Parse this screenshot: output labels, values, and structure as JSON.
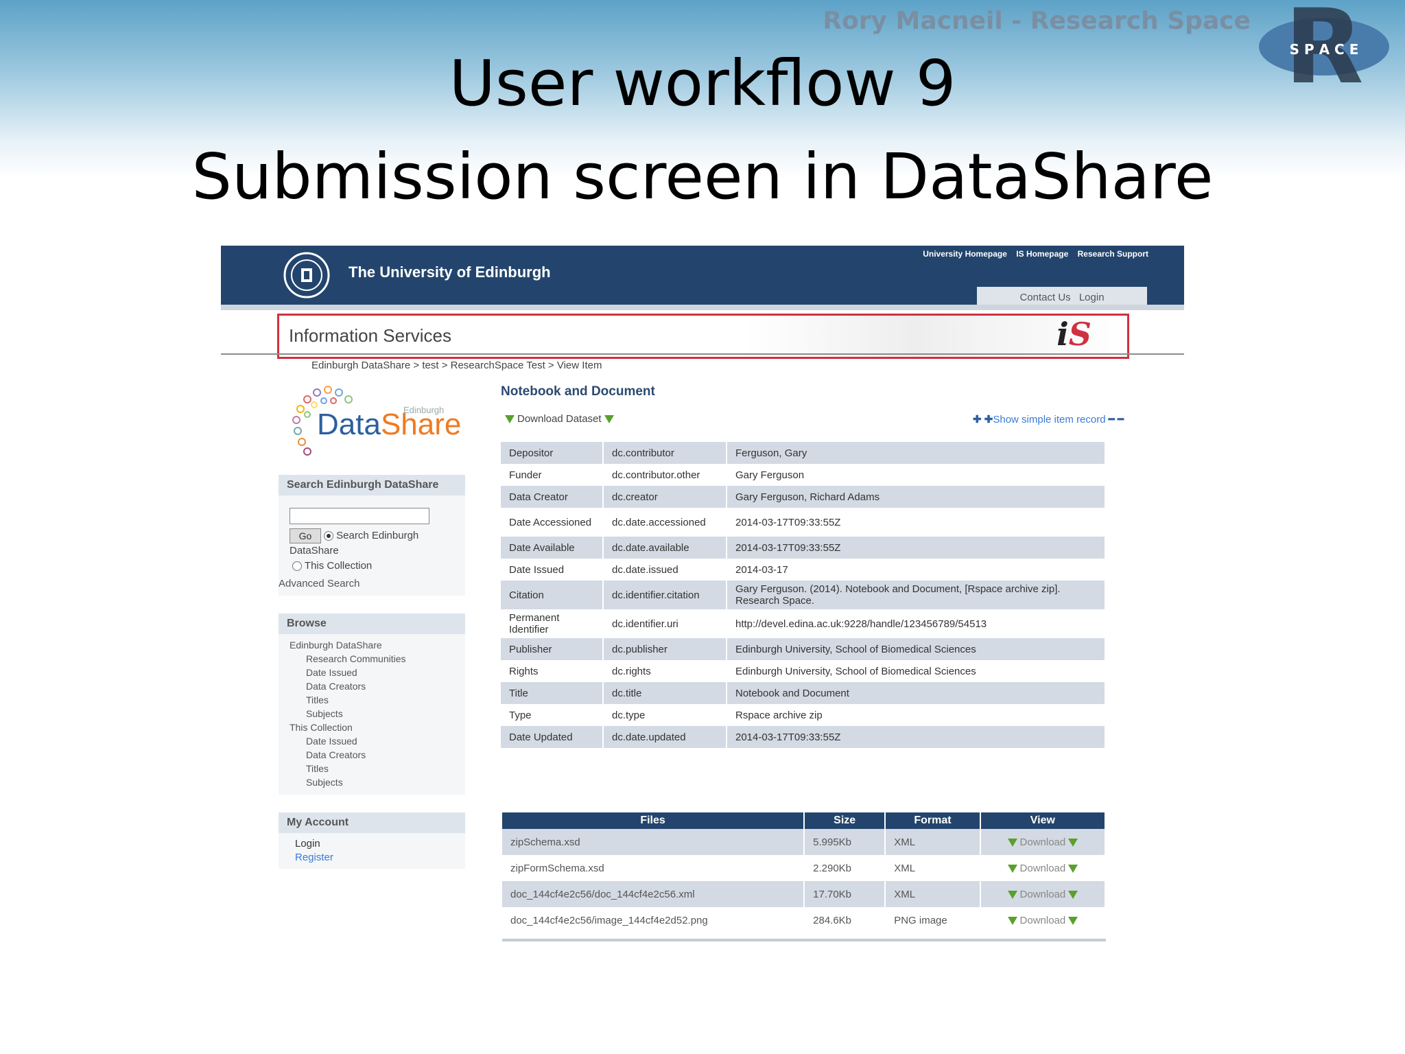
{
  "slide": {
    "author": "Rory Macneil - Research Space",
    "logo_text": "S P A C E",
    "title_line1": "User workflow 9",
    "title_line2": "Submission screen in DataShare"
  },
  "header": {
    "university": "The University of Edinburgh",
    "top_links": [
      "University Homepage",
      "IS Homepage",
      "Research Support"
    ],
    "contact": "Contact Us",
    "login": "Login",
    "section_title": "Information Services",
    "section_logo": "iS"
  },
  "breadcrumb": "Edinburgh DataShare > test > ResearchSpace Test > View Item",
  "datashare_logo": {
    "part1": "Data",
    "part2": "Share",
    "small": "Edinburgh"
  },
  "sidebar": {
    "search": {
      "title": "Search Edinburgh DataShare",
      "go": "Go",
      "option1_a": "Search Edinburgh",
      "option1_b": "DataShare",
      "option2": "This Collection",
      "advanced": "Advanced Search"
    },
    "browse": {
      "title": "Browse",
      "items": [
        {
          "label": "Edinburgh DataShare",
          "indent": false
        },
        {
          "label": "Research Communities",
          "indent": true
        },
        {
          "label": "Date Issued",
          "indent": true
        },
        {
          "label": "Data Creators",
          "indent": true
        },
        {
          "label": "Titles",
          "indent": true
        },
        {
          "label": "Subjects",
          "indent": true
        },
        {
          "label": "This Collection",
          "indent": false
        },
        {
          "label": "Date Issued",
          "indent": true
        },
        {
          "label": "Data Creators",
          "indent": true
        },
        {
          "label": "Titles",
          "indent": true
        },
        {
          "label": "Subjects",
          "indent": true
        }
      ]
    },
    "account": {
      "title": "My Account",
      "login": "Login",
      "register": "Register"
    }
  },
  "item": {
    "title": "Notebook and Document",
    "download_dataset": "Download Dataset",
    "simple_record": "Show simple item record",
    "metadata": [
      {
        "label": "Depositor",
        "field": "dc.contributor",
        "value": "Ferguson, Gary"
      },
      {
        "label": "Funder",
        "field": "dc.contributor.other",
        "value": "Gary Ferguson"
      },
      {
        "label": "Data Creator",
        "field": "dc.creator",
        "value": "Gary Ferguson, Richard Adams"
      },
      {
        "label": "Date Accessioned",
        "field": "dc.date.accessioned",
        "value": "2014-03-17T09:33:55Z"
      },
      {
        "label": "Date Available",
        "field": "dc.date.available",
        "value": "2014-03-17T09:33:55Z"
      },
      {
        "label": "Date Issued",
        "field": "dc.date.issued",
        "value": "2014-03-17"
      },
      {
        "label": "Citation",
        "field": "dc.identifier.citation",
        "value": "Gary Ferguson. (2014). Notebook and Document, [Rspace archive zip]. Research Space."
      },
      {
        "label": "Permanent Identifier",
        "field": "dc.identifier.uri",
        "value": "http://devel.edina.ac.uk:9228/handle/123456789/54513"
      },
      {
        "label": "Publisher",
        "field": "dc.publisher",
        "value": "Edinburgh University, School of Biomedical Sciences"
      },
      {
        "label": "Rights",
        "field": "dc.rights",
        "value": "Edinburgh University, School of Biomedical Sciences"
      },
      {
        "label": "Title",
        "field": "dc.title",
        "value": "Notebook and Document"
      },
      {
        "label": "Type",
        "field": "dc.type",
        "value": "Rspace archive zip"
      },
      {
        "label": "Date Updated",
        "field": "dc.date.updated",
        "value": "2014-03-17T09:33:55Z"
      }
    ],
    "files_headers": [
      "Files",
      "Size",
      "Format",
      "View"
    ],
    "files": [
      {
        "name": "zipSchema.xsd",
        "size": "5.995Kb",
        "format": "XML",
        "view": "Download"
      },
      {
        "name": "zipFormSchema.xsd",
        "size": "2.290Kb",
        "format": "XML",
        "view": "Download"
      },
      {
        "name": "doc_144cf4e2c56/doc_144cf4e2c56.xml",
        "size": "17.70Kb",
        "format": "XML",
        "view": "Download"
      },
      {
        "name": "doc_144cf4e2c56/image_144cf4e2d52.png",
        "size": "284.6Kb",
        "format": "PNG image",
        "view": "Download"
      }
    ]
  }
}
